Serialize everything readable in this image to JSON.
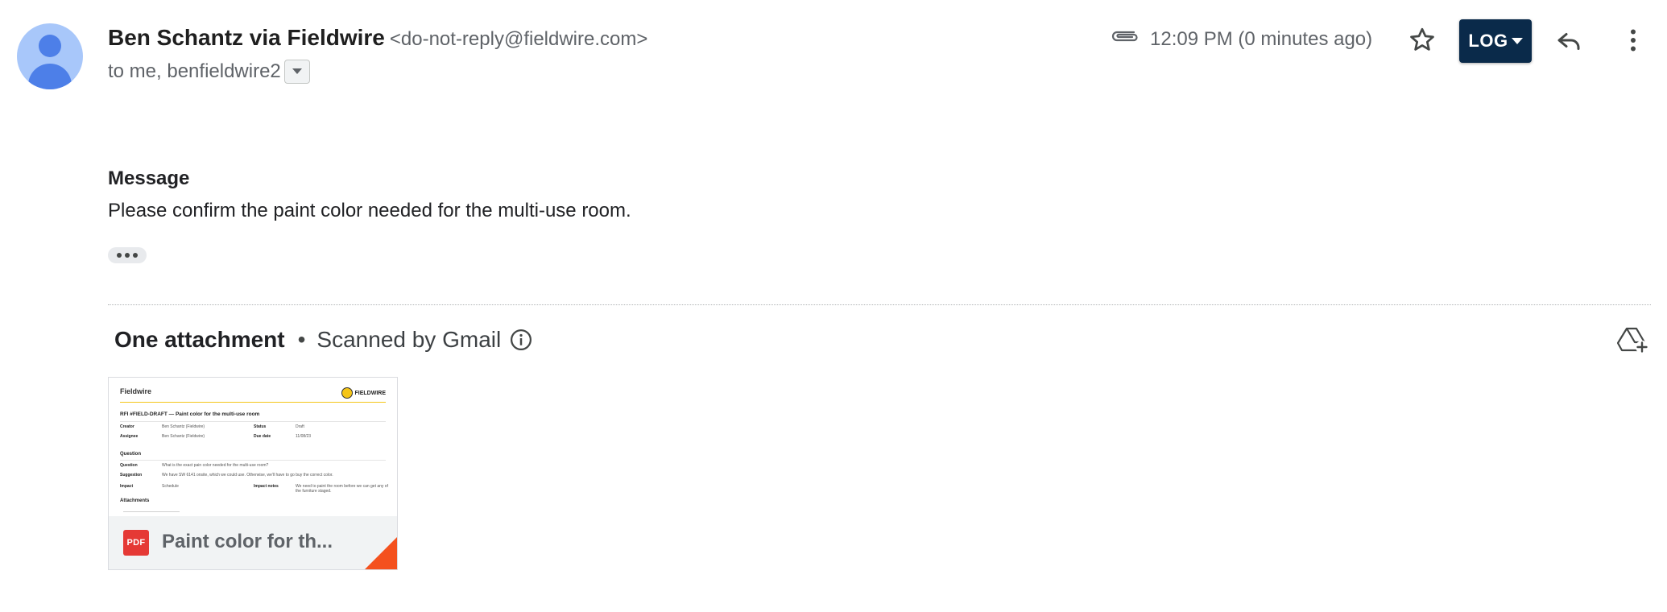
{
  "sender": {
    "name": "Ben Schantz via Fieldwire",
    "email": "<do-not-reply@fieldwire.com>",
    "avatar_color": "#a8c7fa"
  },
  "recipients": "to me, benfieldwire2",
  "header": {
    "timestamp": "12:09 PM (0 minutes ago)",
    "log_button": "LOG",
    "log_button_color": "#0a2a4a",
    "icons": [
      "paperclip-icon",
      "star-icon",
      "reply-icon",
      "more-vert-icon"
    ]
  },
  "message": {
    "heading": "Message",
    "text": "Please confirm the paint color needed for the multi-use room."
  },
  "attachments": {
    "title": "One attachment",
    "separator": "•",
    "scanned": "Scanned by Gmail",
    "file": {
      "name": "Paint color for th...",
      "type_label": "PDF",
      "badge_color": "#e53935",
      "preview": {
        "brand": "Fieldwire",
        "logo_text": "FIELDWIRE",
        "title": "RFI #FIELD-DRAFT — Paint color for the multi-use room",
        "creator_label": "Creator",
        "creator_value": "Ben Schantz (Fieldwire)",
        "status_label": "Status",
        "status_value": "Draft",
        "assignee_label": "Assignee",
        "assignee_value": "Ben Schantz (Fieldwire)",
        "due_label": "Due date",
        "due_value": "11/08/23",
        "question_section": "Question",
        "question_label": "Question",
        "question_value": "What is the exact pain color needed for the multi-use room?",
        "suggestion_label": "Suggestion",
        "suggestion_value": "We have SW 6141 onsite, which we could use. Otherwise, we'll have to go buy the correct color.",
        "impact_label": "Impact",
        "impact_value": "Schedule",
        "impact_notes_label": "Impact notes",
        "impact_notes_value": "We need to paint the room before we can get any of the furniture staged.",
        "attachments_section": "Attachments"
      }
    }
  }
}
